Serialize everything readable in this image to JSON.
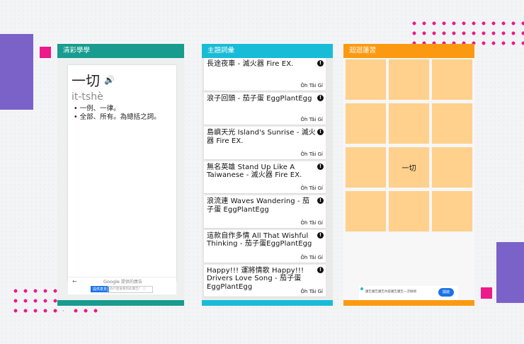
{
  "panels": {
    "dictionary": {
      "title": "清彩學學",
      "word": "一切",
      "romanization": "it-tshè",
      "definitions": [
        "• 一例、一律。",
        "• 全部、所有。為總括之詞。"
      ],
      "ad": {
        "arrow": "←",
        "google_label": "Google",
        "google_sub": "提供的廣告",
        "button": "提供意見",
        "input_text": "為什麼會看到此廣告？ ⓘ"
      }
    },
    "songs": {
      "title": "主題詞彙",
      "items": [
        {
          "title": "長途夜車 - 滅火器 Fire EX.",
          "artist": "Ôh Tâi Gí"
        },
        {
          "title": "浪子回頭 - 茄子蛋 EggPlantEgg",
          "artist": "Ôh Tâi Gí"
        },
        {
          "title": "島嶼天光 Island's Sunrise - 滅火器 Fire EX.",
          "artist": "Ôh Tâi Gí"
        },
        {
          "title": "無名英雄 Stand Up Like A Taiwanese - 滅火器 Fire EX.",
          "artist": "Ôh Tâi Gí"
        },
        {
          "title": "浪流連 Waves Wandering - 茄子蛋 EggPlantEgg",
          "artist": "Ôh Tâi Gí"
        },
        {
          "title": "這款自作多情 All That Wishful Thinking - 茄子蛋EggPlantEgg",
          "artist": "Ôh Tâi Gí"
        },
        {
          "title": "Happy!!! 運將情歌 Happy!!! Drivers Love Song - 茄子蛋 EggPlantEgg",
          "artist": "Ôh Tâi Gí"
        }
      ]
    },
    "game": {
      "title": "迴迴蓮習",
      "tiles": [
        "",
        "",
        "",
        "",
        "",
        "",
        "",
        "一切",
        "",
        "",
        "",
        ""
      ],
      "ad": {
        "text": "廣告廣告廣告內容廣告廣告一次檢視",
        "button": "開啟"
      }
    }
  },
  "colors": {
    "teal": "#179c8f",
    "cyan": "#19bcd6",
    "orange": "#fb9a12",
    "tile": "#ffd18c",
    "purple": "#7b62c9",
    "pink": "#ec1a8b"
  }
}
